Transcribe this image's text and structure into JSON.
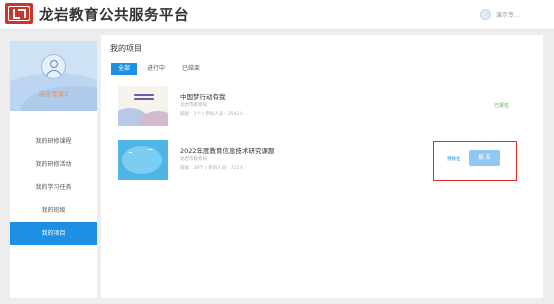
{
  "header": {
    "site_title": "龙岩教育公共服务平台",
    "user_name": "演示专..."
  },
  "sidebar": {
    "user_name": "演示专家2",
    "items": [
      {
        "label": "我的研修课程",
        "active": false
      },
      {
        "label": "我的研修活动",
        "active": false
      },
      {
        "label": "我的学习任务",
        "active": false
      },
      {
        "label": "我的班级",
        "active": false
      },
      {
        "label": "我的项目",
        "active": true
      }
    ]
  },
  "main": {
    "title": "我的项目",
    "tabs": [
      {
        "label": "全部",
        "active": true
      },
      {
        "label": "进行中",
        "active": false
      },
      {
        "label": "已结束",
        "active": false
      }
    ],
    "projects": [
      {
        "title": "中国梦行动有我",
        "org": "龙岩市教育局",
        "meta": "班级：1个 | 参训人员：2542人",
        "status": "已报名"
      },
      {
        "title": "2022年度教育信息技术研究课题",
        "org": "龙岩市教育局",
        "meta": "班级：39个 | 参训人员：721人",
        "pre_signup": "预报名",
        "signup_button": "报 名"
      }
    ]
  },
  "colors": {
    "accent": "#1e90e4",
    "status_green": "#5cb85c",
    "highlight_red": "#e02e2e",
    "sidebar_user": "#f08a4b"
  }
}
